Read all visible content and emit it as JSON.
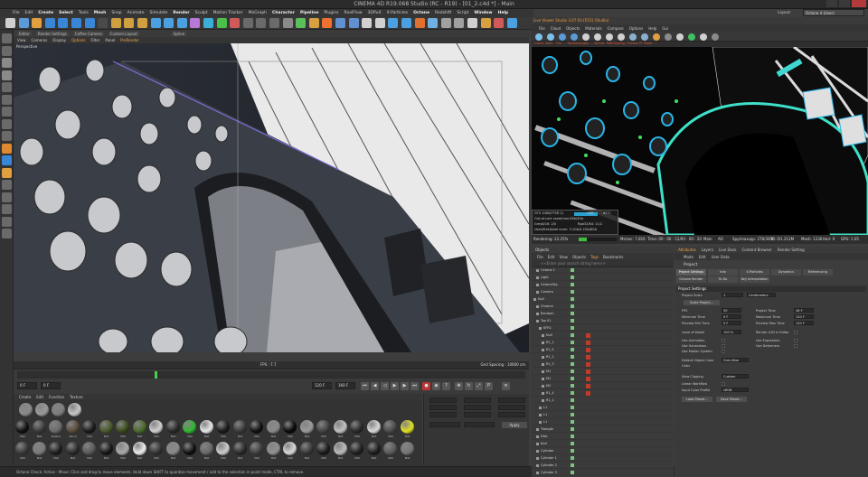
{
  "window": {
    "title": "CINEMA 4D R19.068 Studio (RC - R19) - [01_2.c4d *] - Main"
  },
  "menubar": {
    "items": [
      "File",
      "Edit",
      "Create",
      "Select",
      "Tools",
      "Mesh",
      "Snap",
      "Animate",
      "Simulate",
      "Render",
      "Sculpt",
      "Motion Tracker",
      "MoGraph",
      "Character",
      "Pipeline",
      "Plugins",
      "RealFlow",
      "3DfluX",
      "X-Particles",
      "Octane",
      "Redshift",
      "Script",
      "Window",
      "Help"
    ],
    "active_items": [
      "Create",
      "Select",
      "Mesh",
      "Render",
      "Character",
      "Pipeline",
      "Octane",
      "Window",
      "Help"
    ],
    "layout_label": "Layout:",
    "layout_value": "Octane 4 (User)"
  },
  "viewport": {
    "tabs": [
      "Editor",
      "Render Settings",
      "Coffee Camera",
      "Custom Layout",
      "",
      "Spline"
    ],
    "menu": [
      "View",
      "Cameras",
      "Display",
      "Options",
      "Filter",
      "Panel",
      "ProRender"
    ],
    "menu_highlight": [
      "Options",
      "ProRender"
    ],
    "label": "Perspective",
    "fps": "FPS : 7.7",
    "grid_spacing": "Grid Spacing : 10000 cm"
  },
  "timeline": {
    "current_frame_field": "0 F",
    "start_field": "0 F",
    "end_field": "120 F",
    "end_field2": "160 F",
    "playhead_position": 0.27
  },
  "material_manager": {
    "menu": [
      "Create",
      "Edit",
      "Function",
      "Texture"
    ],
    "materials": [
      {
        "color": "#8a8a8a",
        "label": ""
      },
      {
        "color": "#9a9a9a",
        "label": ""
      },
      {
        "color": "#7d7d7d",
        "label": ""
      },
      {
        "color": "#c8c8c8",
        "label": ""
      },
      {
        "color": "#111111",
        "label": "Mat"
      },
      {
        "color": "#3a3a3a",
        "label": "Mat"
      },
      {
        "color": "#6a6a6a",
        "label": "Rubber"
      },
      {
        "color": "#5a4b3a",
        "label": "Wood"
      },
      {
        "color": "#1a1a1a",
        "label": "Mat"
      },
      {
        "color": "#4a5a2a",
        "label": "Mat"
      },
      {
        "color": "#3a4a1a",
        "label": "Mat"
      },
      {
        "color": "#4a6a2a",
        "label": "Mat"
      },
      {
        "color": "#d0d0d0",
        "label": "Mat"
      },
      {
        "color": "#2a2a2a",
        "label": "Mat"
      },
      {
        "color": "#2fb82f",
        "label": "Mat"
      },
      {
        "color": "#e8e8e8",
        "label": "Mat"
      },
      {
        "color": "#1c1c1c",
        "label": "Mat"
      },
      {
        "color": "#3a3a3a",
        "label": "Mat"
      },
      {
        "color": "#111111",
        "label": "Mat"
      },
      {
        "color": "#8a8a8a",
        "label": "Mat"
      },
      {
        "color": "#0a0a0a",
        "label": "Mat"
      },
      {
        "color": "#9a9a9a",
        "label": "Mat"
      },
      {
        "color": "#444444",
        "label": "Mat"
      },
      {
        "color": "#c0c0c0",
        "label": "Mat"
      },
      {
        "color": "#2a2a2a",
        "label": "Mat"
      },
      {
        "color": "#d8d8d8",
        "label": "Mat"
      },
      {
        "color": "#4a4a4a",
        "label": "Mat"
      },
      {
        "color": "#e0e020",
        "label": "Mat"
      },
      {
        "color": "#3a3a3a",
        "label": "Mat"
      },
      {
        "color": "#7a7a7a",
        "label": "Mat"
      },
      {
        "color": "#1f1f1f",
        "label": "Mat"
      },
      {
        "color": "#2a2a2a",
        "label": "Mat"
      },
      {
        "color": "#5a5a5a",
        "label": "Mat"
      },
      {
        "color": "#181818",
        "label": "Mat"
      },
      {
        "color": "#aaaaaa",
        "label": "Mat"
      },
      {
        "color": "#eeeeee",
        "label": "Mat"
      },
      {
        "color": "#343434",
        "label": "Mat"
      },
      {
        "color": "#8a8a8a",
        "label": "Mat"
      },
      {
        "color": "#101010",
        "label": "Mat"
      },
      {
        "color": "#6a6a6a",
        "label": "Mat"
      },
      {
        "color": "#cccccc",
        "label": "Mat"
      },
      {
        "color": "#2a2a2a",
        "label": "Mat"
      },
      {
        "color": "#404040",
        "label": "Mat"
      },
      {
        "color": "#909090",
        "label": "Mat"
      },
      {
        "color": "#d8d8d8",
        "label": "Mat"
      },
      {
        "color": "#383838",
        "label": "Mat"
      },
      {
        "color": "#1c1c1c",
        "label": "Mat"
      },
      {
        "color": "#bbbbbb",
        "label": "Mat"
      },
      {
        "color": "#202020",
        "label": "Mat"
      },
      {
        "color": "#1e1e1e",
        "label": "Mat"
      },
      {
        "color": "#5a5a5a",
        "label": "Mat"
      },
      {
        "color": "#777777",
        "label": "Mat"
      }
    ]
  },
  "coord_panel": {
    "apply_label": "Apply"
  },
  "status": {
    "text": "Octane Check: Active  - Move: Click and drag to move elements. Hold down SHIFT to quantize movement / add to the selection in point mode, CTRL to remove."
  },
  "render_view": {
    "title": "Live Viewer Studio 3.07 R2-[R15] (Studio)",
    "menu": [
      "File",
      "Cloud",
      "Objects",
      "Materials",
      "Compare",
      "Options",
      "Help",
      "Gui"
    ],
    "stats": "Check: Main - Tris: ... Rendertarget: ... Kernel: PathTracing / Preset-PT Mode ...",
    "gpu": {
      "name": "GTX 1080(FTSR 2)",
      "pct": "%81",
      "temp": "62°C",
      "out_of_core": "Out-of-core used/max:0Kb/4Gb",
      "grey": "Grey8/16: 2/0",
      "rgb": "Rgb32/64: 11/1",
      "used": "Used/free/total vram: 3.1Gb/4.2Gb/8Gb"
    },
    "footer": {
      "rendering": "Rendering: 22.25%",
      "ms": "Ms/sec: 7.816",
      "time": "Time: 00 : 00 : 12/00 : 00 : 20",
      "main": "Main",
      "ao": "AO",
      "spp": "Spp/maxspp: 278/3000",
      "tri": "Tri: 0/1.213M",
      "mesh": "Mesh: 1236",
      "hair": "Hair: 0",
      "rtx": "RTX: off",
      "gpu_ratio": "GPU: 1.05"
    }
  },
  "object_manager": {
    "tab": "Objects",
    "menu": [
      "File",
      "Edit",
      "View",
      "Objects",
      "Tags",
      "Bookmarks"
    ],
    "menu_highlight": "Tags",
    "search_placeholder": "<<Enter your search string here>>",
    "rows": [
      {
        "name": "Octane 1",
        "indent": 1,
        "tag": false
      },
      {
        "name": "Light",
        "indent": 1,
        "tag": false
      },
      {
        "name": "OctaneSky",
        "indent": 1,
        "tag": false
      },
      {
        "name": "Camera",
        "indent": 1,
        "tag": false
      },
      {
        "name": "Null",
        "indent": 0,
        "tag": false
      },
      {
        "name": "Chrome",
        "indent": 1,
        "tag": false
      },
      {
        "name": "Random",
        "indent": 1,
        "tag": false
      },
      {
        "name": "Top 01",
        "indent": 1,
        "tag": false
      },
      {
        "name": "KFR1",
        "indent": 2,
        "tag": false
      },
      {
        "name": "Null",
        "indent": 3,
        "tag": true
      },
      {
        "name": "R1_1",
        "indent": 3,
        "tag": true
      },
      {
        "name": "R1_5",
        "indent": 3,
        "tag": true
      },
      {
        "name": "R1_1",
        "indent": 3,
        "tag": true
      },
      {
        "name": "R1_3",
        "indent": 3,
        "tag": true
      },
      {
        "name": "M1",
        "indent": 3,
        "tag": true
      },
      {
        "name": "M1",
        "indent": 3,
        "tag": true
      },
      {
        "name": "M2",
        "indent": 3,
        "tag": true
      },
      {
        "name": "R1_4",
        "indent": 3,
        "tag": true
      },
      {
        "name": "R1_1",
        "indent": 3,
        "tag": false
      },
      {
        "name": "L1",
        "indent": 2,
        "tag": false
      },
      {
        "name": "L1",
        "indent": 2,
        "tag": false
      },
      {
        "name": "L1",
        "indent": 2,
        "tag": false
      },
      {
        "name": "Triangle",
        "indent": 1,
        "tag": false
      },
      {
        "name": "Disk",
        "indent": 1,
        "tag": false
      },
      {
        "name": "Null",
        "indent": 1,
        "tag": false
      },
      {
        "name": "Cylinder",
        "indent": 1,
        "tag": false
      },
      {
        "name": "Cylinder 1",
        "indent": 1,
        "tag": false
      },
      {
        "name": "Cylinder 2",
        "indent": 1,
        "tag": false
      },
      {
        "name": "Cylinder 3",
        "indent": 1,
        "tag": false
      }
    ]
  },
  "attribute_manager": {
    "tabs": [
      "Attributes",
      "Layers",
      "Live Dock",
      "Content Browser",
      "Render Setting"
    ],
    "tab_highlight": "Attributes",
    "menu": [
      "Mode",
      "Edit",
      "User Data"
    ],
    "title": "Project",
    "subtabs_row1": [
      "Project Settings",
      "Info",
      "X-Particles",
      "Dynamics",
      "Referencing"
    ],
    "subtabs_row2": [
      "Octane Render",
      "To Do",
      "Key Interpolation"
    ],
    "section": "Project Settings",
    "project_scale_label": "Project Scale",
    "project_scale_value": "1",
    "project_scale_unit": "Centimeters",
    "scale_project_btn": "Scale Project...",
    "fps_label": "FPS",
    "fps_value": "30",
    "project_time_label": "Project Time",
    "project_time_value": "46 F",
    "min_time_label": "Minimum Time",
    "min_time_value": "0 F",
    "max_time_label": "Maximum Time",
    "max_time_value": "120 F",
    "prev_min_label": "Preview Min Time",
    "prev_min_value": "0 F",
    "prev_max_label": "Preview Max Time",
    "prev_max_value": "120 F",
    "lod_label": "Level of Detail",
    "lod_value": "100 %",
    "render_lod_label": "Render LOD in Editor",
    "use_anim_label": "Use Animation",
    "use_expr_label": "Use Expression",
    "use_gen_label": "Use Generators",
    "use_deform_label": "Use Deformers",
    "use_motion_label": "Use Motion System",
    "default_obj_color_label": "Default Object Color",
    "default_obj_color_value": "Gray-Blue",
    "color_label": "Color",
    "view_clipping_label": "View Clipping",
    "view_clipping_value": "Custom",
    "linear_workflow_label": "Linear Workflow",
    "input_color_label": "Input Color Profile",
    "input_color_value": "sRGB",
    "load_preset_btn": "Load Preset...",
    "save_preset_btn": "Save Preset..."
  }
}
